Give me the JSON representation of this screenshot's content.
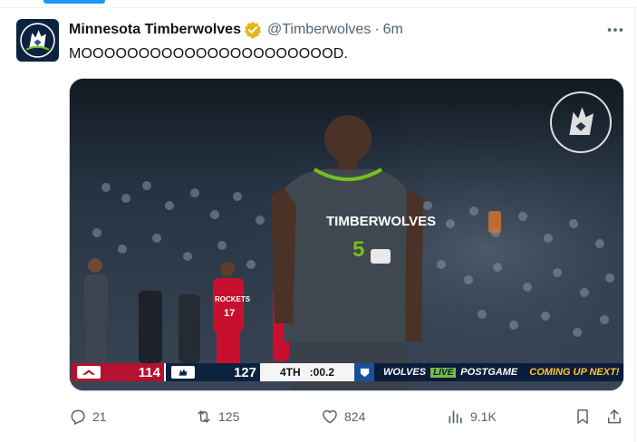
{
  "tweet": {
    "display_name": "Minnesota Timberwolves",
    "handle": "@Timberwolves",
    "separator": "·",
    "time": "6m",
    "text": "MOOOOOOOOOOOOOOOOOOOOOOD."
  },
  "media": {
    "jersey_text": "TIMBERWOLVES",
    "jersey_number": "5",
    "opponent_jersey_text": "ROCKETS",
    "opponent_jersey_number": "17",
    "scorebug": {
      "away_score": "114",
      "home_score": "127",
      "period": "4TH",
      "clock": ":00.2",
      "promo_team": "WOLVES",
      "promo_live": "LIVE",
      "promo_show": "POSTGAME",
      "promo_next": "COMING UP NEXT!"
    }
  },
  "actions": {
    "replies": "21",
    "reposts": "125",
    "likes": "824",
    "views": "9.1K"
  },
  "icons": {
    "more": "more-icon",
    "reply": "reply-icon",
    "repost": "repost-icon",
    "like": "like-icon",
    "views": "views-icon",
    "bookmark": "bookmark-icon",
    "share": "share-icon",
    "verified": "verified-badge-icon"
  },
  "colors": {
    "accent": "#1d9bf0",
    "verified_gold": "#e2b719",
    "text_primary": "#0f1419",
    "text_secondary": "#536471",
    "wolves_navy": "#0c2340",
    "wolves_green": "#78be20",
    "rockets_red": "#b5122f"
  }
}
